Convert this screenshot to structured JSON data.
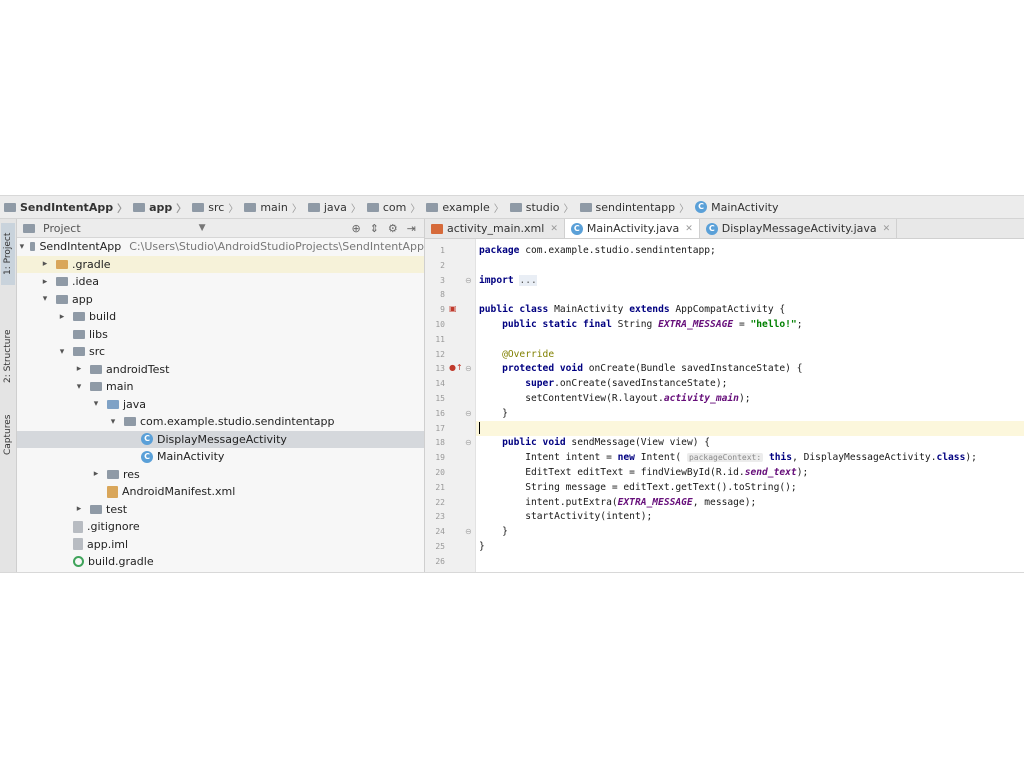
{
  "breadcrumb": [
    {
      "label": "SendIntentApp",
      "icon": "project-icon",
      "bold": true
    },
    {
      "label": "app",
      "icon": "folder-icon",
      "bold": true
    },
    {
      "label": "src",
      "icon": "folder-icon",
      "bold": false
    },
    {
      "label": "main",
      "icon": "folder-icon",
      "bold": false
    },
    {
      "label": "java",
      "icon": "folder-icon",
      "bold": false
    },
    {
      "label": "com",
      "icon": "package-icon",
      "bold": false
    },
    {
      "label": "example",
      "icon": "package-icon",
      "bold": false
    },
    {
      "label": "studio",
      "icon": "package-icon",
      "bold": false
    },
    {
      "label": "sendintentapp",
      "icon": "package-icon",
      "bold": false
    },
    {
      "label": "MainActivity",
      "icon": "class-icon",
      "bold": false
    }
  ],
  "toolstrip": {
    "project": "1: Project",
    "structure": "2: Structure",
    "captures": "Captures"
  },
  "project": {
    "header_title": "Project",
    "tree": [
      {
        "label": "SendIntentApp",
        "path": "C:\\Users\\Studio\\AndroidStudioProjects\\SendIntentApp",
        "arrow": "down",
        "icon": "folder",
        "depth": 0
      },
      {
        "label": ".gradle",
        "arrow": "right",
        "icon": "folder-orange",
        "depth": 1,
        "highlight": true
      },
      {
        "label": ".idea",
        "arrow": "right",
        "icon": "folder",
        "depth": 1
      },
      {
        "label": "app",
        "arrow": "down",
        "icon": "folder",
        "depth": 1
      },
      {
        "label": "build",
        "arrow": "right",
        "icon": "folder",
        "depth": 2
      },
      {
        "label": "libs",
        "arrow": "",
        "icon": "folder",
        "depth": 2
      },
      {
        "label": "src",
        "arrow": "down",
        "icon": "folder",
        "depth": 2
      },
      {
        "label": "androidTest",
        "arrow": "right",
        "icon": "folder",
        "depth": 3
      },
      {
        "label": "main",
        "arrow": "down",
        "icon": "folder",
        "depth": 3
      },
      {
        "label": "java",
        "arrow": "down",
        "icon": "folder-blue",
        "depth": 4
      },
      {
        "label": "com.example.studio.sendintentapp",
        "arrow": "down",
        "icon": "package",
        "depth": 5
      },
      {
        "label": "DisplayMessageActivity",
        "arrow": "",
        "icon": "class",
        "depth": 6,
        "selected": true
      },
      {
        "label": "MainActivity",
        "arrow": "",
        "icon": "class",
        "depth": 6
      },
      {
        "label": "res",
        "arrow": "right",
        "icon": "folder",
        "depth": 4
      },
      {
        "label": "AndroidManifest.xml",
        "arrow": "",
        "icon": "manifest",
        "depth": 4
      },
      {
        "label": "test",
        "arrow": "right",
        "icon": "folder",
        "depth": 3
      },
      {
        "label": ".gitignore",
        "arrow": "",
        "icon": "file",
        "depth": 2
      },
      {
        "label": "app.iml",
        "arrow": "",
        "icon": "file",
        "depth": 2
      },
      {
        "label": "build.gradle",
        "arrow": "",
        "icon": "gradle",
        "depth": 2
      }
    ]
  },
  "editor": {
    "tabs": [
      {
        "label": "activity_main.xml",
        "icon": "xml",
        "active": false
      },
      {
        "label": "MainActivity.java",
        "icon": "class",
        "active": true
      },
      {
        "label": "DisplayMessageActivity.java",
        "icon": "class",
        "active": false
      }
    ],
    "lines": [
      {
        "n": "1",
        "html": "<span class=\"kw\">package</span> com.example.studio.sendintentapp;"
      },
      {
        "n": "2",
        "html": ""
      },
      {
        "n": "3",
        "html": "<span class=\"kw\">import</span> <span class=\"fold-dots\">...</span>"
      },
      {
        "n": "8",
        "html": ""
      },
      {
        "n": "9",
        "html": "<span class=\"kw\">public class</span> MainActivity <span class=\"kw\">extends</span> AppCompatActivity {"
      },
      {
        "n": "10",
        "html": "    <span class=\"kw\">public static final</span> String <span class=\"fld\">EXTRA_MESSAGE</span> = <span class=\"str\">\"hello!\"</span>;"
      },
      {
        "n": "11",
        "html": ""
      },
      {
        "n": "12",
        "html": "    <span class=\"ann\">@Override</span>"
      },
      {
        "n": "13",
        "html": "    <span class=\"kw\">protected void</span> onCreate(Bundle savedInstanceState) {"
      },
      {
        "n": "14",
        "html": "        <span class=\"kw\">super</span>.onCreate(savedInstanceState);"
      },
      {
        "n": "15",
        "html": "        setContentView(R.layout.<span class=\"fld\">activity_main</span>);"
      },
      {
        "n": "16",
        "html": "    }"
      },
      {
        "n": "17",
        "html": "<span class=\"caret\"></span>",
        "current": true
      },
      {
        "n": "18",
        "html": "    <span class=\"kw\">public void</span> sendMessage(View view) {"
      },
      {
        "n": "19",
        "html": "        Intent intent = <span class=\"kw\">new</span> Intent( <span class=\"hint\">packageContext:</span> <span class=\"kw\">this</span>, DisplayMessageActivity.<span class=\"kw\">class</span>);"
      },
      {
        "n": "20",
        "html": "        EditText editText = findViewById(R.id.<span class=\"fld\">send_text</span>);"
      },
      {
        "n": "21",
        "html": "        String message = editText.getText().toString();"
      },
      {
        "n": "22",
        "html": "        intent.putExtra(<span class=\"fld\">EXTRA_MESSAGE</span>, message);"
      },
      {
        "n": "23",
        "html": "        startActivity(intent);"
      },
      {
        "n": "24",
        "html": "    }"
      },
      {
        "n": "25",
        "html": "}"
      },
      {
        "n": "26",
        "html": ""
      }
    ]
  }
}
